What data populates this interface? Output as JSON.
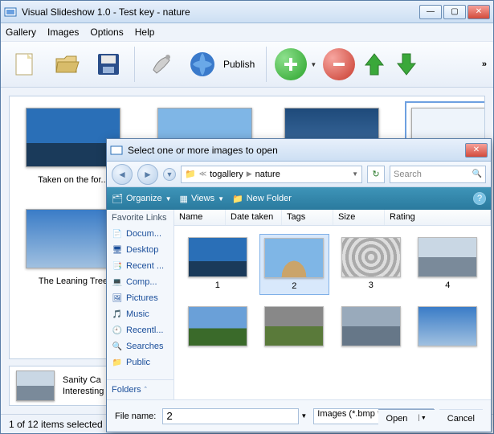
{
  "main": {
    "title": "Visual Slideshow 1.0 - Test key - nature",
    "menu": {
      "gallery": "Gallery",
      "images": "Images",
      "options": "Options",
      "help": "Help"
    },
    "toolbar": {
      "publish": "Publish"
    },
    "gallery": {
      "items": [
        {
          "caption": "Taken on the for..."
        },
        {
          "caption": ""
        },
        {
          "caption": ""
        },
        {
          "caption": "The Leaning Tree"
        }
      ]
    },
    "detail": {
      "line1": "Sanity Ca",
      "line2": "Interesting"
    },
    "status": "1 of 12 items selected"
  },
  "dialog": {
    "title": "Select one or more images to open",
    "breadcrumb": {
      "seg1": "togallery",
      "seg2": "nature"
    },
    "search_placeholder": "Search",
    "toolbar": {
      "organize": "Organize",
      "views": "Views",
      "newfolder": "New Folder"
    },
    "sidebar": {
      "header": "Favorite Links",
      "items": [
        {
          "label": "Docum..."
        },
        {
          "label": "Desktop"
        },
        {
          "label": "Recent ..."
        },
        {
          "label": "Comp..."
        },
        {
          "label": "Pictures"
        },
        {
          "label": "Music"
        },
        {
          "label": "Recentl..."
        },
        {
          "label": "Searches"
        },
        {
          "label": "Public"
        }
      ],
      "folders": "Folders"
    },
    "columns": {
      "name": "Name",
      "date": "Date taken",
      "tags": "Tags",
      "size": "Size",
      "rating": "Rating"
    },
    "thumbs": [
      {
        "label": "1"
      },
      {
        "label": "2"
      },
      {
        "label": "3"
      },
      {
        "label": "4"
      },
      {
        "label": ""
      },
      {
        "label": ""
      },
      {
        "label": ""
      },
      {
        "label": ""
      }
    ],
    "bottom": {
      "filename_label": "File name:",
      "filename_value": "2",
      "filetype": "Images (*.bmp *.dib *.rle *.jpg *",
      "open": "Open",
      "cancel": "Cancel"
    }
  }
}
